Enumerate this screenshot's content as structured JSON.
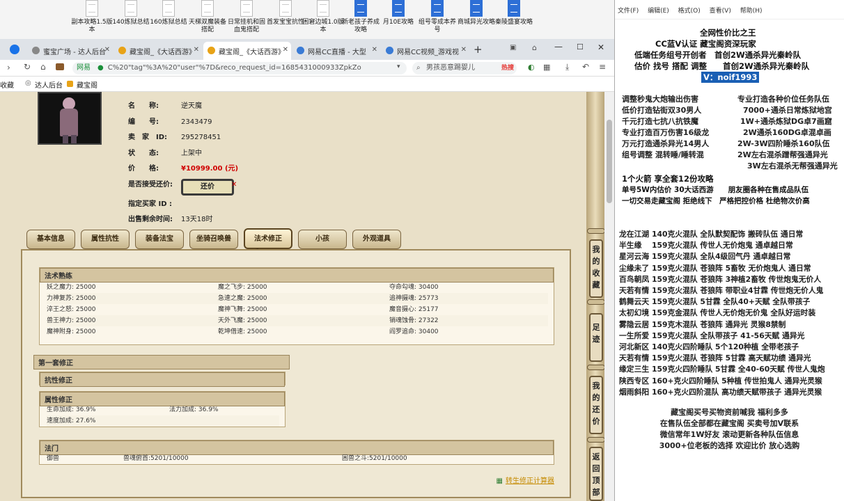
{
  "desktop": {
    "icons": [
      {
        "label": "副本攻略1.5版本",
        "color": "white"
      },
      {
        "label": "140炼狱总结",
        "color": "white"
      },
      {
        "label": "160炼狱总结",
        "color": "white"
      },
      {
        "label": "天梯双魔装备搭配",
        "color": "white"
      },
      {
        "label": "日常挂机和固血鬼搭配",
        "color": "white"
      },
      {
        "label": "首发宝宝抗性",
        "color": "white"
      },
      {
        "label": "困窘边城1.0版本",
        "color": "white"
      },
      {
        "label": "新老孩子养成攻略",
        "color": "blue"
      },
      {
        "label": "月10E攻略",
        "color": "blue"
      },
      {
        "label": "组号零成本养号",
        "color": "blue"
      },
      {
        "label": "商城异光攻略",
        "color": "blue"
      },
      {
        "label": "秦陵盛宴攻略",
        "color": "blue"
      }
    ]
  },
  "browser": {
    "tabs": [
      {
        "label": "蜜宝广场 - 达人后台",
        "active": false
      },
      {
        "label": "藏宝阁_《大话西游》",
        "active": false
      },
      {
        "label": "藏宝阁_《大话西游》",
        "active": true
      },
      {
        "label": "网易CC直播 - 大型",
        "active": false
      },
      {
        "label": "网易CC视频_游戏视",
        "active": false
      }
    ],
    "address": "C%20\"tag\"%3A%20\"user\"%7D&reco_request_id=1685431000933ZpkZo",
    "address_prefix": "网易",
    "search_placeholder": "男孩恶意踢婴儿",
    "hot_label": "热搜",
    "bookmarks": [
      "收藏",
      "达人后台",
      "藏宝阁"
    ]
  },
  "item": {
    "name_label": "名　　称:",
    "name": "逆天魔",
    "id_label": "编　　号:",
    "id": "2343479",
    "seller_label": "卖　家　ID:",
    "seller_id": "295278451",
    "status_label": "状　　态:",
    "status": "上架中",
    "price_label": "价　　格:",
    "price": "¥10999.00 (元)",
    "bargain_label": "是否接受还价:",
    "bargain_button": "还价",
    "buyer_label": "指定买家 ID :",
    "time_label": "出售剩余时间:",
    "time_left": "13天18时"
  },
  "tabs": [
    "基本信息",
    "属性抗性",
    "装备法宝",
    "坐骑召唤兽",
    "法术修正",
    "小孩",
    "外观道具"
  ],
  "active_tab": "法术修正",
  "spell_mastery": {
    "title": "法术熟练",
    "rows": [
      [
        "妖之魔力: 25000",
        "魔之飞步: 25000",
        "夺命勾魂: 30400"
      ],
      [
        "力神复苏: 25000",
        "急速之魔: 25000",
        "追神摄魂: 25773"
      ],
      [
        "淬王之怒: 25000",
        "魔神飞舞: 25000",
        "魔音摄心: 25177"
      ],
      [
        "兽王神力: 25000",
        "天外飞魔: 25000",
        "销魂蚀骨: 27322"
      ],
      [
        "魔神附身: 25000",
        "乾坤借速: 25000",
        "阎罗追命: 30400"
      ]
    ]
  },
  "first_correction": {
    "title": "第一套修正",
    "resist_title": "抗性修正",
    "attr_title": "属性修正",
    "attr_rows": [
      [
        "生命加成: 36.9%",
        "法力加成: 36.9%"
      ],
      [
        "速度加成: 27.6%",
        ""
      ]
    ],
    "gate_title": "法门",
    "gate_row": [
      "御兽",
      "兽魂俯首:5201/10000",
      "困兽之斗:5201/10000"
    ],
    "calc_link": "转生修正计算器"
  },
  "side_buttons": [
    "我的收藏",
    "足迹",
    "我的还价",
    "返回顶部"
  ],
  "notepad": {
    "menu": [
      "文件(F)",
      "编辑(E)",
      "格式(O)",
      "查看(V)",
      "帮助(H)"
    ],
    "header": [
      "全网性价比之王",
      "CC蓝V认证 藏宝阁资深玩家",
      "低端任务组号开创者　首创2W通杀异光秦岭队",
      "估价 找号 搭配 调整　　首创2W通杀异光秦岭队"
    ],
    "contact": "V：noif1993",
    "services_left": [
      "调整秒鬼大炮输出伤害",
      "低价打造钻街双30男人",
      "千元打造七抗八抗铁魔",
      "专业打造百万伤害16级龙",
      "万元打造通杀异光14男人",
      "组号调整 混转睡/睡转混"
    ],
    "services_right": [
      "专业打造各种价位任务队伍",
      "7000+通杀日常炼狱地宫",
      "1W+通杀炼狱DG卓7画窟",
      "2W通杀160DG卓混卓画",
      "2W-3W四阶睡杀160队伍",
      "2W左右混杀蹭帮强通异光",
      "3W左右混杀无帮强通异光"
    ],
    "mid": [
      "1个火箭 享全套12份攻略",
      "单号5W内估价 30大话西游　　朋友圈各种在售成品队伍",
      "一切交易走藏宝阁 拒绝线下　严格把控价格 杜绝物次价高"
    ],
    "list": [
      "龙在江湖 140克火混队 全队默契配饰 搬砖队伍 通日常",
      "半生缘　 159克火混队 传世人无价炮鬼 通卓越日常",
      "星河云海 159克火混队 全队4级回气丹 通卓越日常",
      "尘缘未了 159克火混队 苍狼阵 5畜牧 无价炮鬼人 通日常",
      "百鸟朝凤 159克火混队 苍狼阵 3神植2畜牧 传世炮鬼无价人",
      "天若有情 159克火混队 苍狼阵 带职业4甘霖 传世炮无价人鬼",
      "鹤舞云天 159克火混队 5甘霖 全队40+天赋 全队带孩子",
      "太初幻境 159克金混队 传世人无价炮无价鬼 全队好运时装",
      "雾隐云居 159克木混队 苍狼阵 通异光 灵猴8禁制",
      "一生所爱 159克火混队 全队带孩子 41-56天赋 通异光",
      "河北新区 140克火四阶睡队 5个120种植 全带老孩子",
      "天若有情 159克火混队 苍狼阵 5甘霖 高天赋功绩 通异光",
      "缘定三生 159克火四阶睡队 5甘霖 全40-60天赋 传世人鬼炮",
      "陕西专区 160+克火四阶睡队 5种植 传世拍鬼人 通异光灵猴",
      "烟雨斜阳 160+克火四阶混队 高功绩天赋带孩子 通异光灵猴"
    ],
    "footer": [
      "藏宝阁买号买物资前喊我 福利多多",
      "在售队伍全部都在藏宝阁 买卖号加V联系",
      "微信常年1W好友 滚动更新各种队伍信息",
      "3000+位老板的选择 欢迎比价 放心选购"
    ]
  },
  "colors": {
    "price": "#d00000",
    "frame": "#a08a5c",
    "page_bg": "#e9e0c8",
    "contact_bg": "#1a5fb4"
  }
}
